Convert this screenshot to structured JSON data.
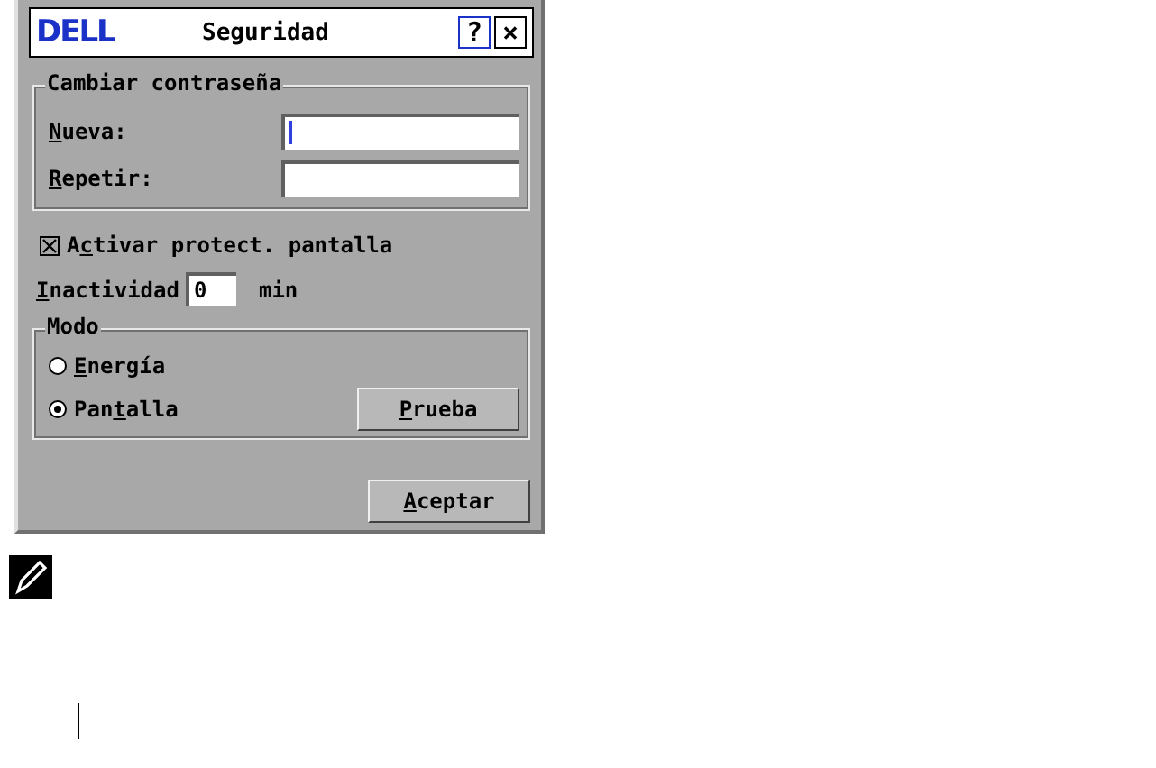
{
  "window": {
    "logo": "DELL",
    "title": "Seguridad",
    "help_button": "?",
    "close_button": "×"
  },
  "password_group": {
    "title": "Cambiar contraseña",
    "fields": [
      {
        "label": {
          "key": "N",
          "post": "ueva:"
        },
        "focused": true
      },
      {
        "label": {
          "key": "R",
          "post": "epetir:"
        },
        "focused": false
      }
    ]
  },
  "screensaver": {
    "checked": true,
    "label": {
      "pre": "A",
      "key": "c",
      "post": "tivar protect. pantalla"
    }
  },
  "inactivity": {
    "label": {
      "key": "I",
      "post": "nactividad"
    },
    "value": "0",
    "unit": "min"
  },
  "mode_group": {
    "title": "Modo",
    "options": [
      {
        "label": {
          "key": "E",
          "post": "nergía"
        },
        "selected": false
      },
      {
        "label": {
          "pre": "Pan",
          "key": "t",
          "post": "alla"
        },
        "selected": true
      }
    ],
    "test_button": {
      "key": "P",
      "post": "rueba"
    }
  },
  "ok_button": {
    "key": "A",
    "post": "ceptar"
  }
}
